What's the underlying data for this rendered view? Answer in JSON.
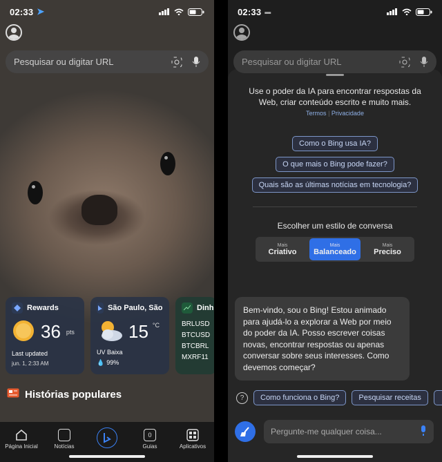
{
  "left": {
    "status": {
      "time": "02:33"
    },
    "search": {
      "placeholder": "Pesquisar ou digitar URL"
    },
    "cards": {
      "rewards": {
        "title": "Rewards",
        "points": "36",
        "unit": "pts",
        "updated_label": "Last updated",
        "updated_time": "jun. 1, 2:33 AM"
      },
      "weather": {
        "title": "São Paulo, São P",
        "temp": "15",
        "unit": "°C",
        "uv": "UV Baixa",
        "humidity": "99%"
      },
      "money": {
        "title": "Dinh",
        "tickers": [
          "BRLUSD",
          "BTCUSD",
          "BTCBRL",
          "MXRF11"
        ]
      }
    },
    "stories_title": "Histórias populares",
    "tabs": {
      "home": "Página Inicial",
      "news": "Notícias",
      "tabs_label": "Guias",
      "tabs_count": "0",
      "apps": "Aplicativos"
    }
  },
  "right": {
    "status": {
      "time": "02:33"
    },
    "search": {
      "placeholder": "Pesquisar ou digitar URL"
    },
    "intro": "Use o poder da IA para encontrar respostas da Web, criar conteúdo escrito e muito mais.",
    "links": {
      "terms": "Termos",
      "privacy": "Privacidade"
    },
    "suggestions": [
      "Como o Bing usa IA?",
      "O que mais o Bing pode fazer?",
      "Quais são as últimas notícias em tecnologia?"
    ],
    "style_heading": "Escolher um estilo de conversa",
    "styles": [
      {
        "more": "Mais",
        "label": "Criativo"
      },
      {
        "more": "Mais",
        "label": "Balanceado"
      },
      {
        "more": "Mais",
        "label": "Preciso"
      }
    ],
    "welcome": "Bem-vindo, sou o Bing! Estou animado para ajudá-lo a explorar a Web por meio do poder da IA. Posso escrever coisas novas, encontrar respostas ou apenas conversar sobre seus interesses. Como devemos começar?",
    "quick": [
      "Como funciona o Bing?",
      "Pesquisar receitas"
    ],
    "compose_placeholder": "Pergunte-me qualquer coisa..."
  },
  "colors": {
    "accent": "#2f6fe6",
    "sun": "#f2b233"
  }
}
